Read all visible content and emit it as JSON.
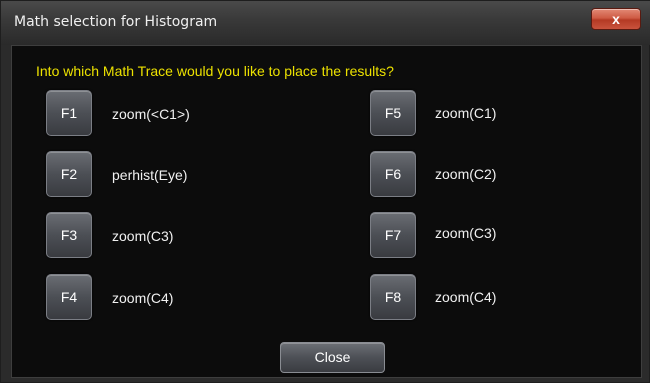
{
  "window": {
    "title": "Math selection for Histogram",
    "close_glyph": "x"
  },
  "prompt": "Into which Math Trace would you like to place the results?",
  "traces": [
    {
      "key": "F1",
      "label": "zoom(<C1>)"
    },
    {
      "key": "F2",
      "label": "perhist(Eye)"
    },
    {
      "key": "F3",
      "label": "zoom(C3)"
    },
    {
      "key": "F4",
      "label": "zoom(C4)"
    },
    {
      "key": "F5",
      "label": "zoom(C1)"
    },
    {
      "key": "F6",
      "label": "zoom(C2)"
    },
    {
      "key": "F7",
      "label": "zoom(C3)"
    },
    {
      "key": "F8",
      "label": "zoom(C4)"
    }
  ],
  "close_label": "Close",
  "colors": {
    "prompt": "#ede200",
    "background": "#0c0c0c",
    "close_button_red": "#cf5b44"
  }
}
